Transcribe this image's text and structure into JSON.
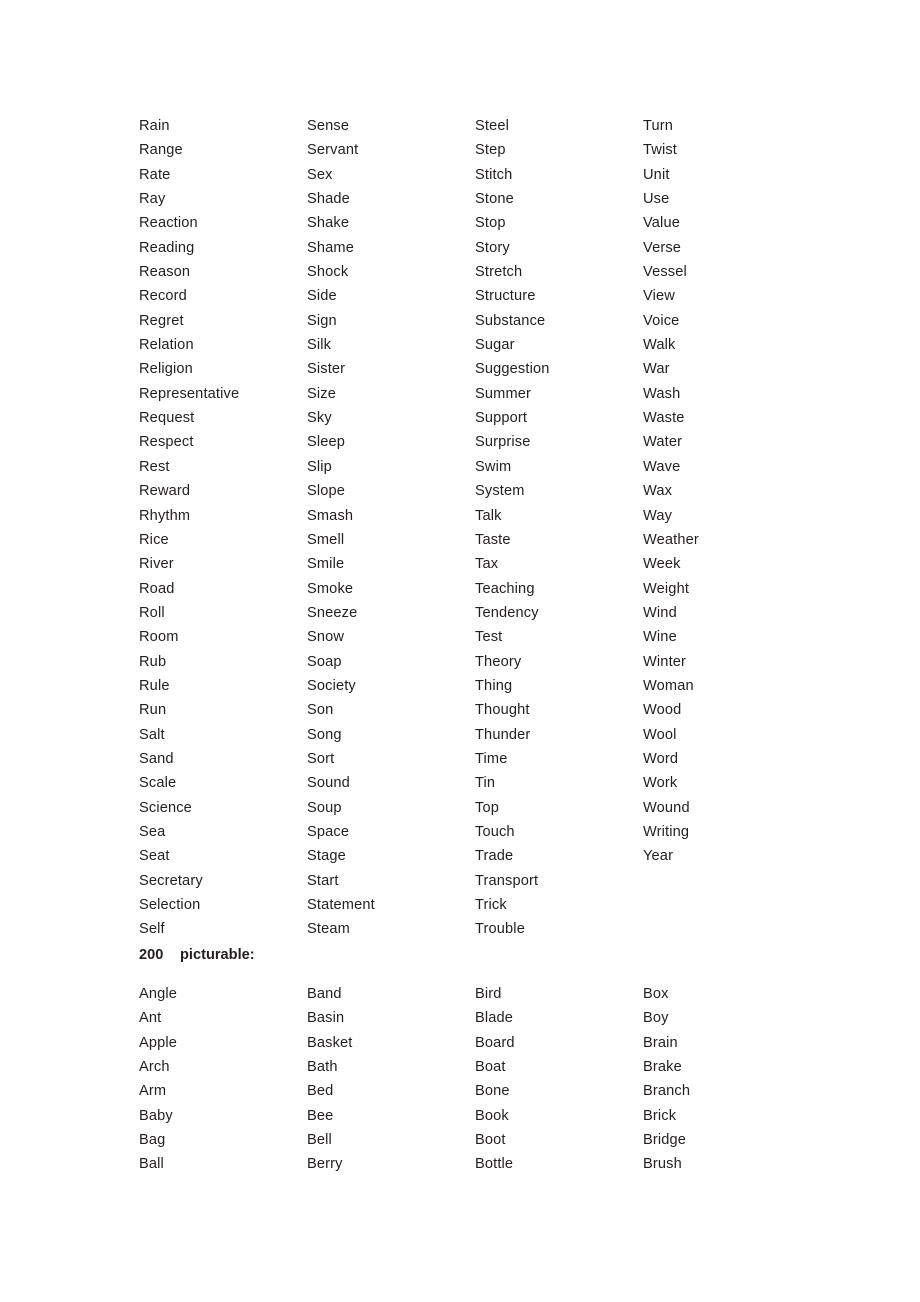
{
  "document": {
    "background_color": "#ffffff",
    "text_color": "#231f20"
  },
  "sections": [
    {
      "id": "general",
      "heading": null,
      "columns": [
        {
          "id": "general-col-1",
          "words": [
            "Rain",
            "Range",
            "Rate",
            "Ray",
            "Reaction",
            "Reading",
            "Reason",
            "Record",
            "Regret",
            "Relation",
            "Religion",
            "Representative",
            "Request",
            "Respect",
            "Rest",
            "Reward",
            "Rhythm",
            "Rice",
            "River",
            "Road",
            "Roll",
            "Room",
            "Rub",
            "Rule",
            "Run",
            "Salt",
            "Sand",
            "Scale",
            "Science",
            "Sea",
            "Seat",
            "Secretary",
            "Selection",
            "Self"
          ]
        },
        {
          "id": "general-col-2",
          "words": [
            "Sense",
            "Servant",
            "Sex",
            "Shade",
            "Shake",
            "Shame",
            "Shock",
            "Side",
            "Sign",
            "Silk",
            "Sister",
            "Size",
            "Sky",
            "Sleep",
            "Slip",
            "Slope",
            "Smash",
            "Smell",
            "Smile",
            "Smoke",
            "Sneeze",
            "Snow",
            "Soap",
            "Society",
            "Son",
            "Song",
            "Sort",
            "Sound",
            "Soup",
            "Space",
            "Stage",
            "Start",
            "Statement",
            "Steam"
          ]
        },
        {
          "id": "general-col-3",
          "words": [
            "Steel",
            "Step",
            "Stitch",
            "Stone",
            "Stop",
            "Story",
            "Stretch",
            "Structure",
            "Substance",
            "Sugar",
            "Suggestion",
            "Summer",
            "Support",
            "Surprise",
            "Swim",
            "System",
            "Talk",
            "Taste",
            "Tax",
            "Teaching",
            "Tendency",
            "Test",
            "Theory",
            "Thing",
            "Thought",
            "Thunder",
            "Time",
            "Tin",
            "Top",
            "Touch",
            "Trade",
            "Transport",
            "Trick",
            "Trouble"
          ]
        },
        {
          "id": "general-col-4",
          "words": [
            "Turn",
            "Twist",
            "Unit",
            "Use",
            "Value",
            "Verse",
            "Vessel",
            "View",
            "Voice",
            "Walk",
            "War",
            "Wash",
            "Waste",
            "Water",
            "Wave",
            "Wax",
            "Way",
            "Weather",
            "Week",
            "Weight",
            "Wind",
            "Wine",
            "Winter",
            "Woman",
            "Wood",
            "Wool",
            "Word",
            "Work",
            "Wound",
            "Writing",
            "Year"
          ]
        }
      ]
    },
    {
      "id": "picturable",
      "heading": {
        "count": "200",
        "label": "picturable:"
      },
      "columns": [
        {
          "id": "picturable-col-1",
          "words": [
            "Angle",
            "Ant",
            "Apple",
            "Arch",
            "Arm",
            "Baby",
            "Bag",
            "Ball"
          ]
        },
        {
          "id": "picturable-col-2",
          "words": [
            "Band",
            "Basin",
            "Basket",
            "Bath",
            "Bed",
            "Bee",
            "Bell",
            "Berry"
          ]
        },
        {
          "id": "picturable-col-3",
          "words": [
            "Bird",
            "Blade",
            "Board",
            "Boat",
            "Bone",
            "Book",
            "Boot",
            "Bottle"
          ]
        },
        {
          "id": "picturable-col-4",
          "words": [
            "Box",
            "Boy",
            "Brain",
            "Brake",
            "Branch",
            "Brick",
            "Bridge",
            "Brush"
          ]
        }
      ]
    }
  ]
}
